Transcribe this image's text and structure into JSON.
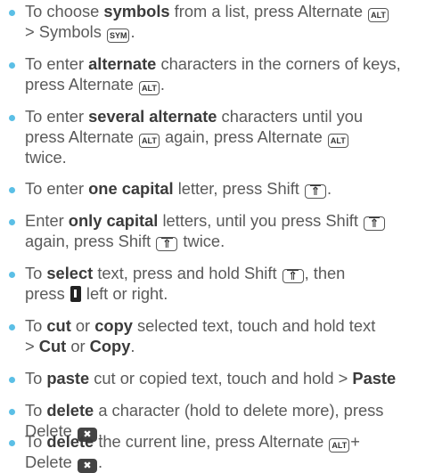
{
  "keys": {
    "alt": "ALT",
    "sym": "SYM",
    "shift": "⇑",
    "delete": "✖"
  },
  "items": [
    {
      "t1": "To choose ",
      "b1": "symbols",
      "t2": " from a list, press Alternate ",
      "t3": "> Symbols "
    },
    {
      "t1": "To enter ",
      "b1": "alternate",
      "t2": " characters in the corners of keys,",
      "t3": "press Alternate "
    },
    {
      "t1": "To enter ",
      "b1": "several alternate",
      "t2": " characters until you",
      "t3": "press Alternate ",
      "t4": " again, press Alternate ",
      "t5": "twice."
    },
    {
      "t1": "To enter ",
      "b1": "one capital",
      "t2": " letter, press Shift "
    },
    {
      "t1": "Enter ",
      "b1": "only capital",
      "t2": " letters, until you press Shift ",
      "t3": "again, press Shift ",
      "t4": " twice."
    },
    {
      "t1": "To ",
      "b1": "select",
      "t2": " text, press and hold Shift ",
      "t3": ", then",
      "t4": "press ",
      "t5": " left or right."
    },
    {
      "t1": "To ",
      "b1": "cut",
      "t2": " or ",
      "b2": "copy",
      "t3": " selected text, touch and hold text",
      "t4": "> ",
      "b3": "Cut",
      "t5": " or ",
      "b4": "Copy",
      "t6": "."
    },
    {
      "t1": "To ",
      "b1": "paste",
      "t2": " cut or copied text, touch and hold > ",
      "b2": "Paste"
    },
    {
      "t1": "To ",
      "b1": "delete",
      "t2": " a character (hold to delete more), press",
      "t3": "Delete "
    },
    {
      "t1": "To ",
      "b1": "delete",
      "t2": " the current line, press Alternate ",
      "t3": "+",
      "t4": "Delete "
    }
  ],
  "punct": {
    "period": "."
  }
}
